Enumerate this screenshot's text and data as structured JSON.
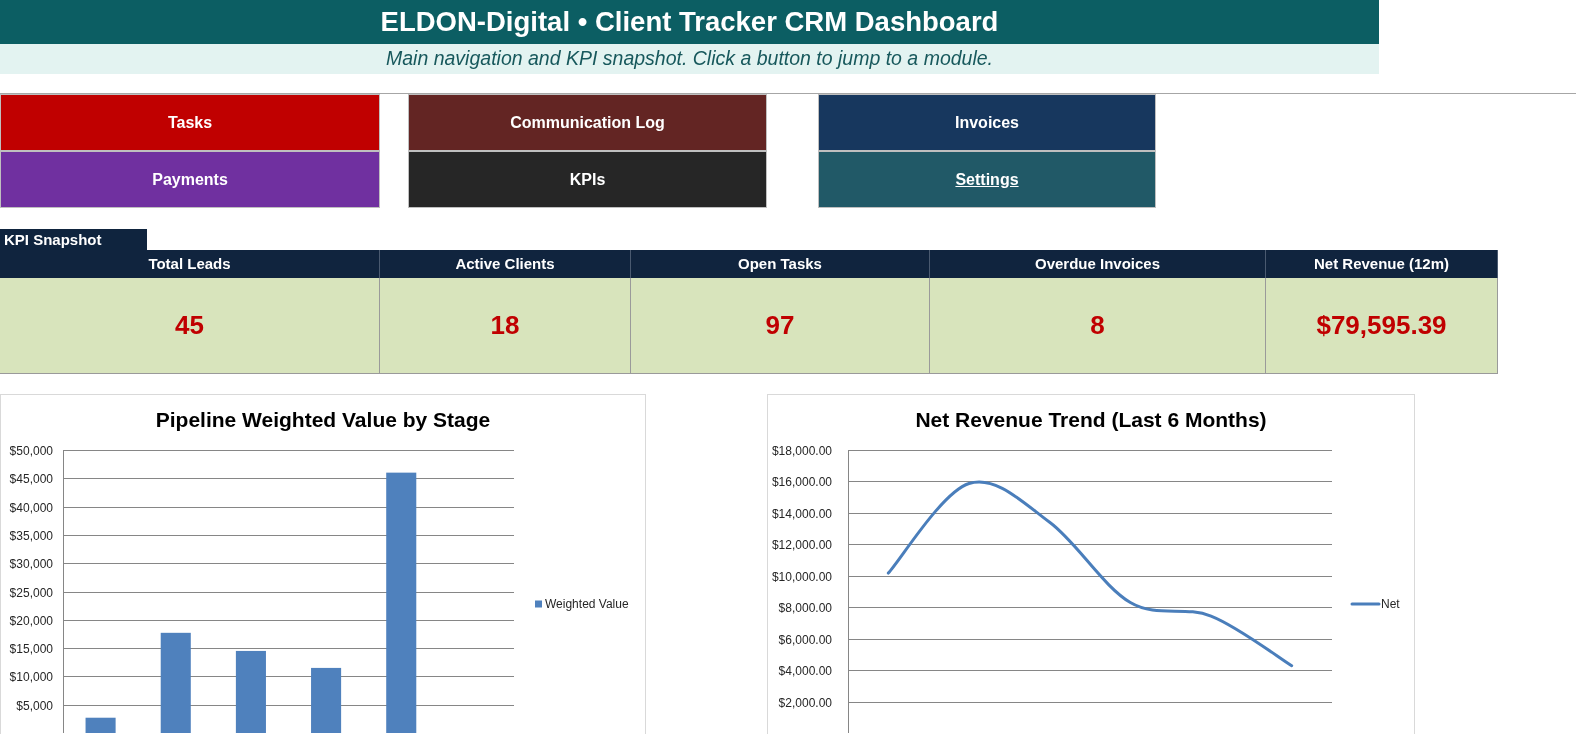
{
  "header": {
    "title": "ELDON-Digital • Client Tracker CRM Dashboard",
    "subtitle": "Main navigation and KPI snapshot. Click a button to jump to a module."
  },
  "nav_buttons": [
    {
      "label": "Tasks",
      "color": "#c00000",
      "underlined": false
    },
    {
      "label": "Communication Log",
      "color": "#632523",
      "underlined": false
    },
    {
      "label": "Invoices",
      "color": "#17375e",
      "underlined": false
    },
    {
      "label": "Payments",
      "color": "#7030a0",
      "underlined": false
    },
    {
      "label": "KPIs",
      "color": "#262626",
      "underlined": false
    },
    {
      "label": "Settings",
      "color": "#215967",
      "underlined": true
    }
  ],
  "kpi_snapshot": {
    "title": "KPI Snapshot",
    "kpis": [
      {
        "label": "Total Leads",
        "value": "45"
      },
      {
        "label": "Active Clients",
        "value": "18"
      },
      {
        "label": "Open Tasks",
        "value": "97"
      },
      {
        "label": "Overdue Invoices",
        "value": "8"
      },
      {
        "label": "Net Revenue (12m)",
        "value": "$79,595.39"
      }
    ]
  },
  "charts": [
    {
      "chart_data": {
        "type": "bar",
        "title": "Pipeline Weighted Value by Stage",
        "grid": true,
        "series": [
          {
            "name": "Weighted Value",
            "color": "#4f81bd",
            "values": [
              2700,
              17700,
              14500,
              11500,
              46000,
              0
            ]
          }
        ],
        "ylim": [
          0,
          50000
        ],
        "yticks": [
          {
            "value": 5000,
            "label": "$5,000"
          },
          {
            "value": 10000,
            "label": "$10,000"
          },
          {
            "value": 15000,
            "label": "$15,000"
          },
          {
            "value": 20000,
            "label": "$20,000"
          },
          {
            "value": 25000,
            "label": "$25,000"
          },
          {
            "value": 30000,
            "label": "$30,000"
          },
          {
            "value": 35000,
            "label": "$35,000"
          },
          {
            "value": 40000,
            "label": "$40,000"
          },
          {
            "value": 45000,
            "label": "$45,000"
          },
          {
            "value": 50000,
            "label": "$50,000"
          }
        ]
      }
    },
    {
      "chart_data": {
        "type": "line",
        "title": "Net Revenue Trend (Last 6 Months)",
        "grid": true,
        "series": [
          {
            "name": "Net",
            "color": "#4a7ebb",
            "values": [
              10170,
              15870,
              13400,
              8300,
              7440,
              4280
            ]
          }
        ],
        "ylim": [
          0,
          18000
        ],
        "yticks": [
          {
            "value": 2000,
            "label": "$2,000.00"
          },
          {
            "value": 4000,
            "label": "$4,000.00"
          },
          {
            "value": 6000,
            "label": "$6,000.00"
          },
          {
            "value": 8000,
            "label": "$8,000.00"
          },
          {
            "value": 10000,
            "label": "$10,000.00"
          },
          {
            "value": 12000,
            "label": "$12,000.00"
          },
          {
            "value": 14000,
            "label": "$14,000.00"
          },
          {
            "value": 16000,
            "label": "$16,000.00"
          },
          {
            "value": 18000,
            "label": "$18,000.00"
          }
        ]
      }
    }
  ]
}
